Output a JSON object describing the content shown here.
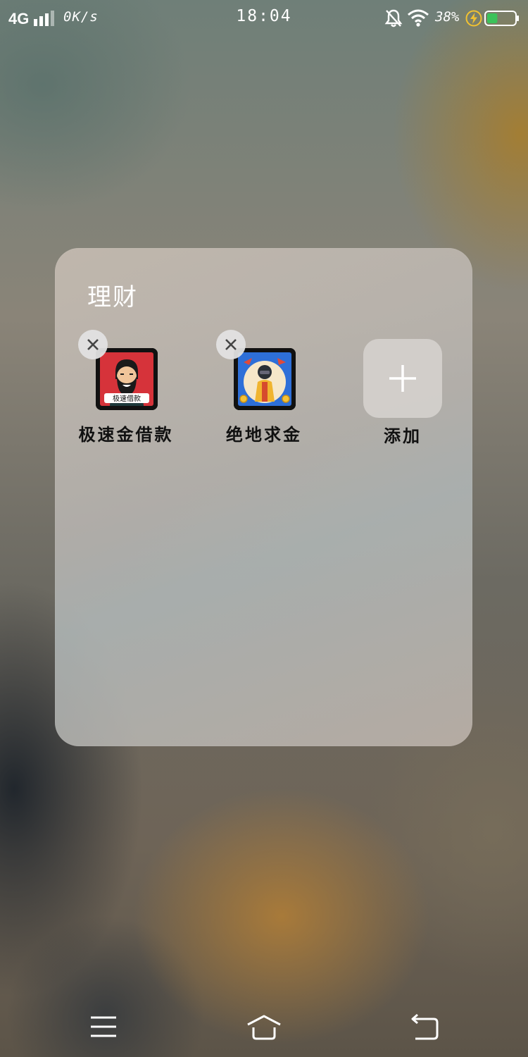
{
  "status_bar": {
    "network": "4G",
    "speed": "0K/s",
    "time": "18:04",
    "battery_percent": "38%",
    "battery_level": 0.38,
    "icons": [
      "signal-icon",
      "bell-off-icon",
      "wifi-icon",
      "charging-icon",
      "battery-icon"
    ]
  },
  "folder": {
    "title": "理财",
    "apps": [
      {
        "label": "极速金借款",
        "icon_badge_text": "极速借款",
        "icon": "bearded-man-app-icon"
      },
      {
        "label": "绝地求金",
        "icon": "soldier-game-app-icon"
      }
    ],
    "add_label": "添加"
  },
  "navigation": {
    "buttons": [
      "menu-icon",
      "home-icon",
      "back-icon"
    ]
  },
  "colors": {
    "battery_fill": "#3cc25a",
    "charge_bolt": "#f2c230",
    "app1_bg": "#d6333a",
    "app2_bg": "#2e6fd8"
  }
}
